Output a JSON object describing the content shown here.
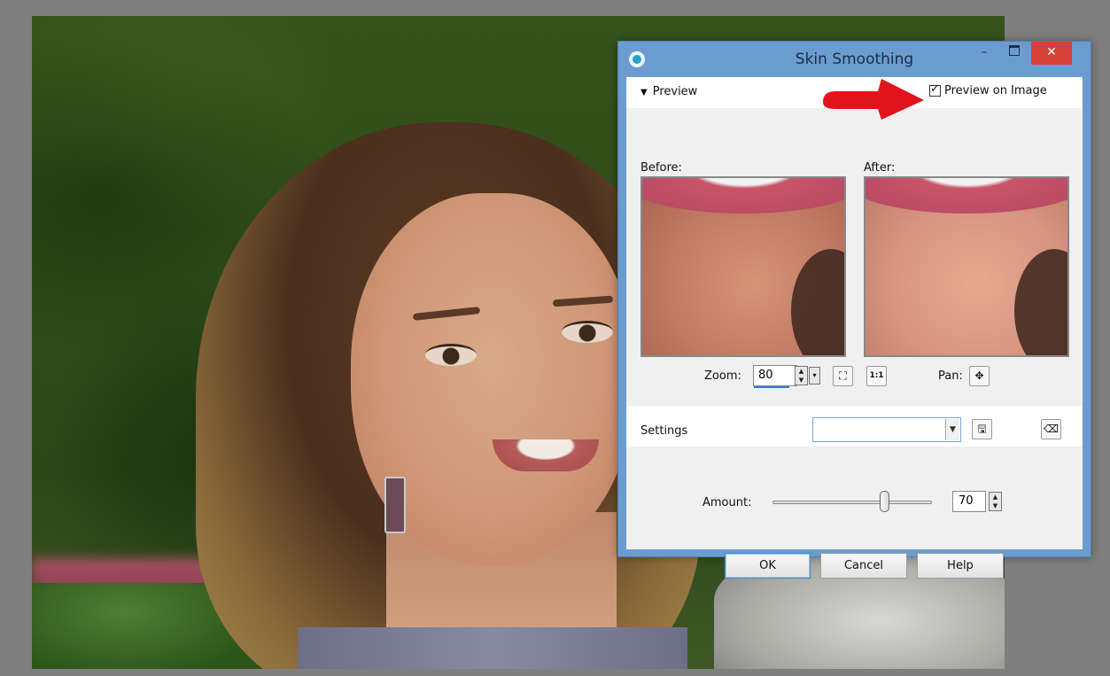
{
  "dialog": {
    "title": "Skin Smoothing",
    "minimize_glyph": "–",
    "close_glyph": "✕",
    "preview_label": "Preview",
    "preview_on_image_label": "Preview on Image",
    "preview_on_image_checked": true,
    "before_label": "Before:",
    "after_label": "After:",
    "zoom_label": "Zoom:",
    "zoom_value": "80",
    "pan_label": "Pan:",
    "settings_label": "Settings",
    "settings_value": "",
    "amount_label": "Amount:",
    "amount_value": "70",
    "amount_fraction": 0.7,
    "ok_label": "OK",
    "cancel_label": "Cancel",
    "help_label": "Help"
  },
  "icons": {
    "app": "paintshop-icon",
    "zoom_fit": "fit-to-window-icon",
    "zoom_actual": "actual-size-icon",
    "pan": "move-icon",
    "save_preset": "save-icon",
    "reset": "reset-eraser-icon",
    "annotation": "red-arrow-icon"
  },
  "colors": {
    "titlebar": "#6b9ccf",
    "close_button": "#d8403a",
    "annotation_arrow": "#e0141b"
  }
}
